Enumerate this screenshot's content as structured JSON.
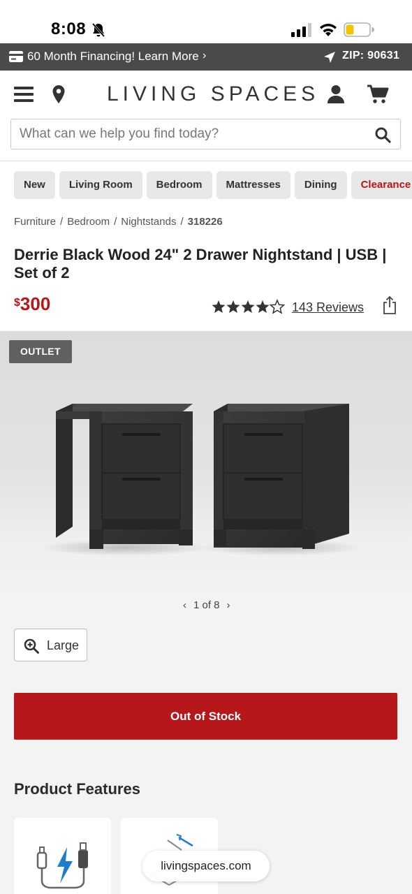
{
  "status_bar": {
    "time": "8:08"
  },
  "promo": {
    "text": "60 Month Financing! Learn More",
    "chevron": "›",
    "zip": "ZIP: 90631"
  },
  "header": {
    "logo": "LIVING SPACES"
  },
  "search": {
    "placeholder": "What can we help you find today?"
  },
  "categories": [
    "New",
    "Living Room",
    "Bedroom",
    "Mattresses",
    "Dining",
    "Clearance"
  ],
  "breadcrumb": {
    "items": [
      "Furniture",
      "Bedroom",
      "Nightstands"
    ],
    "current": "318226",
    "separator": "/"
  },
  "product": {
    "title": "Derrie Black Wood 24\" 2 Drawer Nightstand | USB | Set of 2",
    "price_currency": "$",
    "price_amount": "300",
    "rating": 4.5,
    "reviews": "143 Reviews",
    "badge": "OUTLET"
  },
  "gallery": {
    "prev": "‹",
    "position": "1 of 8",
    "next": "›"
  },
  "large_button": {
    "label": "Large"
  },
  "stock_button": {
    "label": "Out of Stock"
  },
  "features": {
    "title": "Product Features"
  },
  "browser": {
    "url": "livingspaces.com"
  },
  "colors": {
    "accent_red": "#b5171a",
    "promo_bg": "#4a4a4a",
    "badge_bg": "#606060"
  }
}
